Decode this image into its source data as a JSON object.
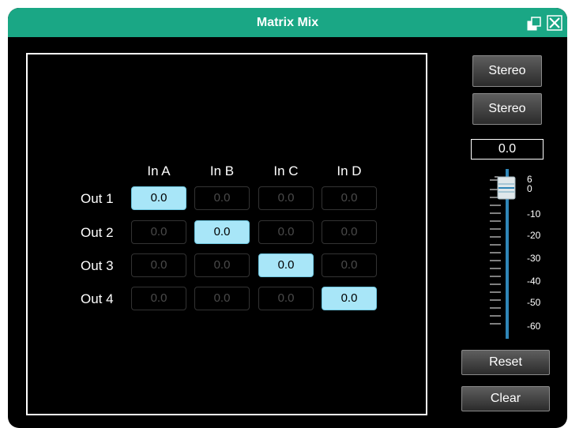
{
  "window": {
    "title": "Matrix Mix",
    "accent_color": "#1aa785",
    "controls": [
      "restore-icon",
      "close-icon"
    ]
  },
  "matrix": {
    "columns": [
      "In A",
      "In B",
      "In C",
      "In D"
    ],
    "rows": [
      {
        "label": "Out 1",
        "cells": [
          "0.0",
          "0.0",
          "0.0",
          "0.0"
        ],
        "active": [
          true,
          false,
          false,
          false
        ]
      },
      {
        "label": "Out 2",
        "cells": [
          "0.0",
          "0.0",
          "0.0",
          "0.0"
        ],
        "active": [
          false,
          true,
          false,
          false
        ]
      },
      {
        "label": "Out 3",
        "cells": [
          "0.0",
          "0.0",
          "0.0",
          "0.0"
        ],
        "active": [
          false,
          false,
          true,
          false
        ]
      },
      {
        "label": "Out 4",
        "cells": [
          "0.0",
          "0.0",
          "0.0",
          "0.0"
        ],
        "active": [
          false,
          false,
          false,
          true
        ]
      }
    ],
    "active_color": "#a8e6f8"
  },
  "side": {
    "stereo_1": "Stereo",
    "stereo_2": "Stereo",
    "value": "0.0",
    "scale": [
      "6",
      "0",
      "-10",
      "-20",
      "-30",
      "-40",
      "-50",
      "-60"
    ],
    "reset": "Reset",
    "clear": "Clear"
  }
}
